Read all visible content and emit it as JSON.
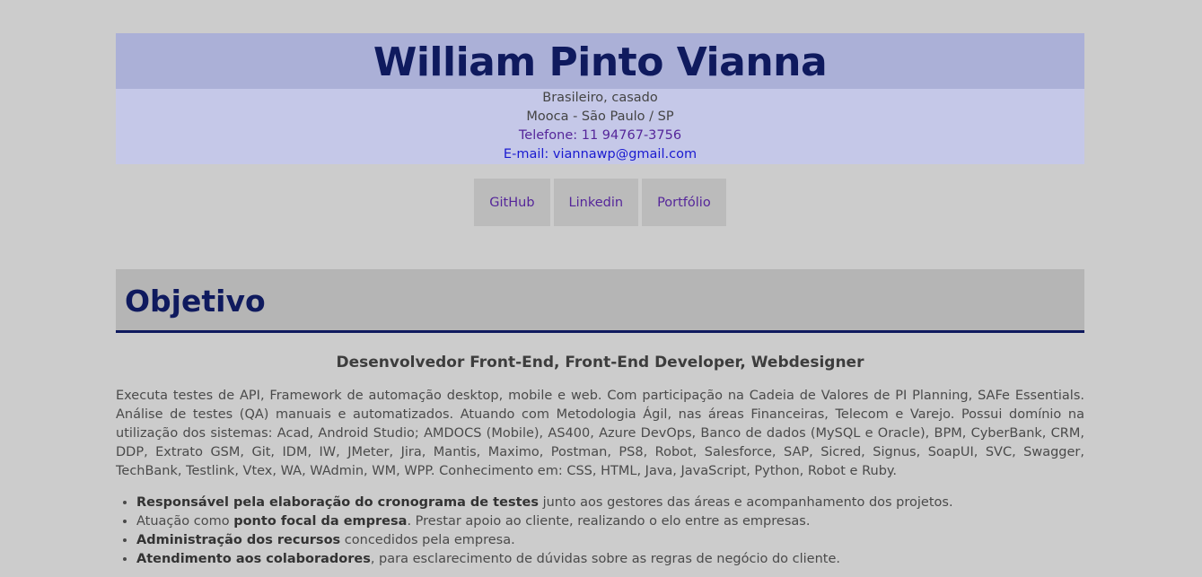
{
  "header": {
    "name": "William Pinto Vianna",
    "nationality": "Brasileiro, casado",
    "location": "Mooca - São Paulo / SP",
    "phone": "Telefone: 11 94767-3756",
    "email_prefix": "E-mail: ",
    "email": "viannawp@gmail.com"
  },
  "nav": {
    "github": "GitHub",
    "linkedin": "Linkedin",
    "portfolio": "Portfólio"
  },
  "objective": {
    "title": "Objetivo",
    "role": "Desenvolvedor Front-End, Front-End Developer, Webdesigner",
    "summary": "Executa testes de API, Framework de automação desktop, mobile e web. Com participação na Cadeia de Valores de PI Planning, SAFe Essentials. Análise de testes (QA) manuais e automatizados. Atuando com Metodologia Ágil, nas áreas Financeiras, Telecom e Varejo. Possui domínio na utilização dos sistemas: Acad, Android Studio; AMDOCS (Mobile), AS400, Azure DevOps, Banco de dados (MySQL e Oracle), BPM, CyberBank, CRM, DDP, Extrato GSM, Git, IDM, IW, JMeter, Jira, Mantis, Maximo, Postman, PS8, Robot, Salesforce, SAP, Sicred, Signus, SoapUI, SVC, Swagger, TechBank, Testlink, Vtex, WA, WAdmin, WM, WPP. Conhecimento em: CSS, HTML, Java, JavaScript, Python, Robot e Ruby.",
    "bullets": [
      {
        "pre": "",
        "bold": "Responsável pela elaboração do cronograma de testes",
        "post": " junto aos gestores das áreas e acompanhamento dos projetos."
      },
      {
        "pre": "Atuação como ",
        "bold": "ponto focal da empresa",
        "post": ". Prestar apoio ao cliente, realizando o elo entre as empresas."
      },
      {
        "pre": "",
        "bold": "Administração dos recursos",
        "post": " concedidos pela empresa."
      },
      {
        "pre": "",
        "bold": "Atendimento aos colaboradores",
        "post": ", para esclarecimento de dúvidas sobre as regras de negócio do cliente."
      }
    ]
  }
}
